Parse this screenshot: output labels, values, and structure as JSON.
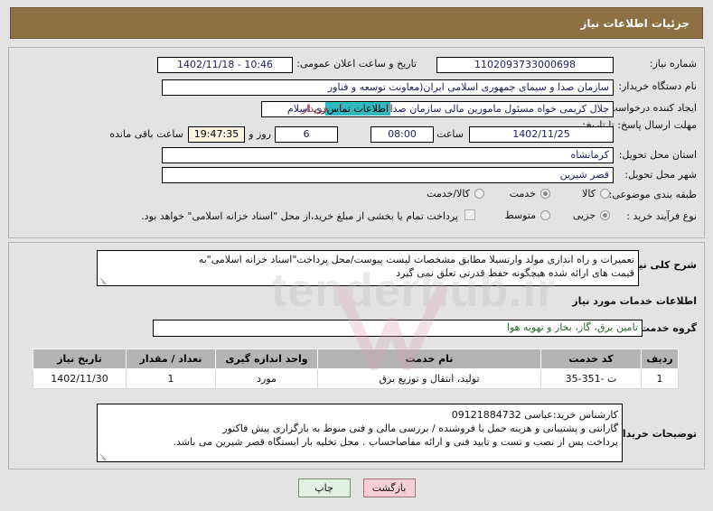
{
  "header": {
    "title": "جزئیات اطلاعات نیاز"
  },
  "form": {
    "need_number": {
      "label": "شماره نیاز:",
      "value": "1102093733000698"
    },
    "announce_datetime": {
      "label": "تاریخ و ساعت اعلان عمومی:",
      "value": "1402/11/18 - 10:46"
    },
    "buyer_org": {
      "label": "نام دستگاه خریدار:",
      "value": "سازمان صدا و سیمای جمهوری اسلامی ایران(معاونت توسعه و فناور"
    },
    "requester": {
      "label": "ایجاد کننده درخواست:",
      "value": "جلال کریمی خواه مسئول مامورین مالی  سازمان صدا و سیمای جمهوری اسلام",
      "contact_link": "اطلاعات تماس",
      "contact_link_suffix": "خریدار"
    },
    "deadline": {
      "label": "مهلت ارسال پاسخ: تا تاریخ:",
      "date": "1402/11/25",
      "time_label": "ساعت",
      "time": "08:00",
      "days": "6",
      "days_label": "روز و",
      "countdown": "19:47:35",
      "countdown_label": "ساعت باقی مانده"
    },
    "province": {
      "label": "استان محل تحویل:",
      "value": "کرمانشاه"
    },
    "city": {
      "label": "شهر محل تحویل:",
      "value": "قصر شیرین"
    },
    "category": {
      "label": "طبقه بندی موضوعی:",
      "options": [
        "کالا",
        "خدمت",
        "کالا/خدمت"
      ],
      "selected": "خدمت"
    },
    "process_type": {
      "label": "نوع فرآیند خرید :",
      "options": [
        "جزیی",
        "متوسط"
      ],
      "selected": "جزیی"
    },
    "payment_note": {
      "checked": true,
      "text": "پرداخت تمام یا بخشی از مبلغ خرید،از محل \"اسناد خزانه اسلامی\" خواهد بود."
    }
  },
  "details": {
    "summary": {
      "label": "شرح کلی نیاز:",
      "line1": "تعمیرات و راه اندازی مولد وارتسیلا مطابق مشخصات لیست پیوست/محل پرداخت\"اسناد خزانه اسلامی\"به",
      "line2": "قیمت های ارائه شده هیچگونه حفظ قدرتی تعلق نمی گیرد"
    },
    "services_heading": "اطلاعات خدمات مورد نیاز",
    "service_group": {
      "label": "گروه خدمت:",
      "value": "تامین برق، گاز، بخار و تهویه هوا"
    },
    "table": {
      "columns": [
        "ردیف",
        "کد خدمت",
        "نام خدمت",
        "واحد اندازه گیری",
        "تعداد / مقدار",
        "تاریخ نیاز"
      ],
      "rows": [
        {
          "row_no": "1",
          "service_code": "ت -351-35",
          "service_name": "تولید، انتقال و توزیع برق",
          "unit": "مورد",
          "quantity": "1",
          "need_date": "1402/11/30"
        }
      ]
    },
    "buyer_notes": {
      "label": "توضیحات خریدار:",
      "line1": "کارشناس خرید:عباسی 09121884732",
      "line2": "گارانتی و پشتیبانی و هزینه حمل با فروشنده / بررسی مالی و فنی منوط به بارگزاری پیش فاکتور",
      "line3": "پرداخت پس از نصب و تست و تایید فنی و ارائه مفاصاحساب . محل تخلیه بار ایستگاه قصر شیرین می باشد."
    }
  },
  "footer": {
    "print_label": "چاپ",
    "back_label": "بازگشت"
  },
  "watermark": {
    "text": "tenderhub.ir"
  },
  "colors": {
    "header_bg": "#8d7144",
    "accent_link": "#2fb9bf",
    "link_red": "#b03030",
    "table_header_bg": "#b4b4b4",
    "print_btn_bg": "#e2f2e2",
    "back_btn_bg": "#f6cfd6"
  }
}
